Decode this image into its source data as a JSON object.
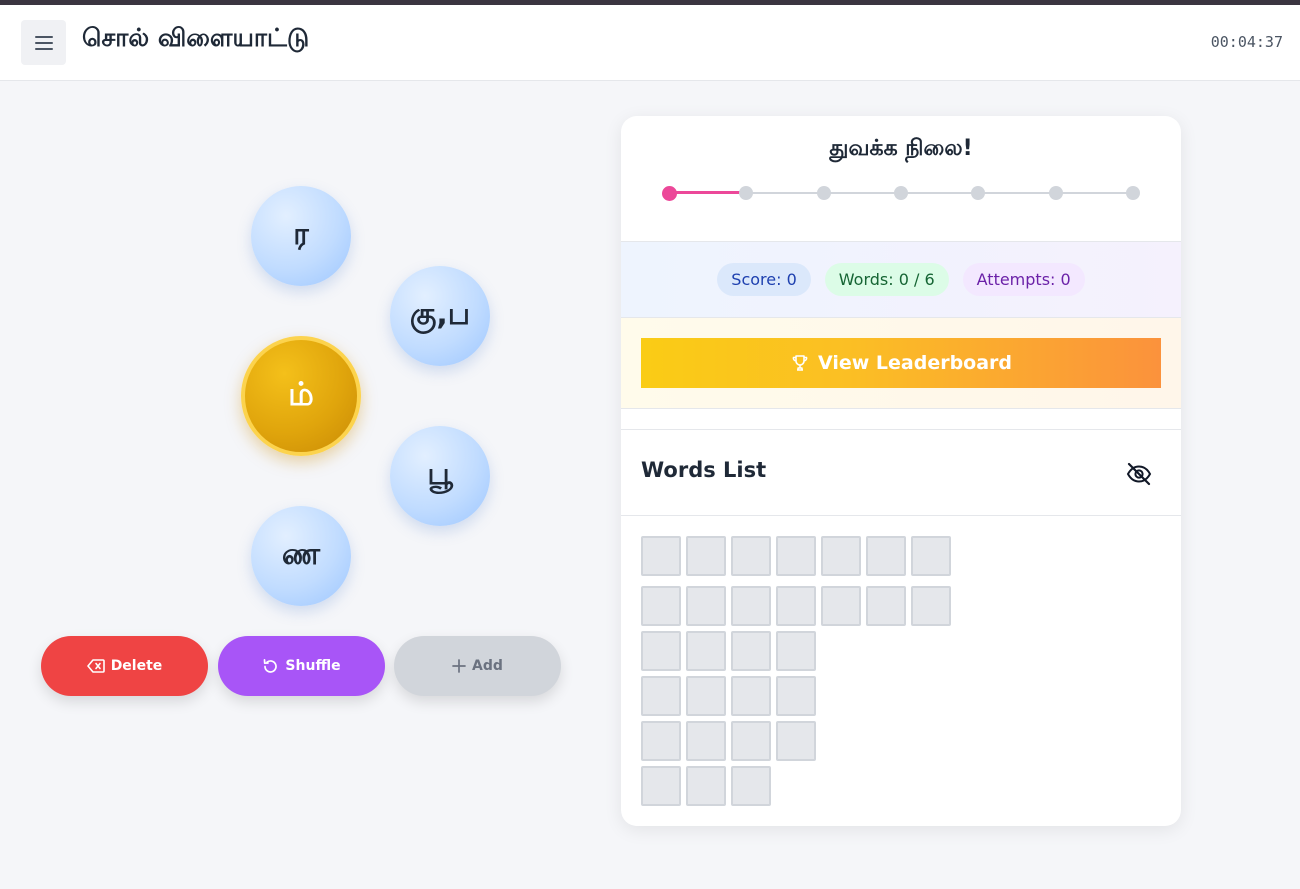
{
  "header": {
    "menu_icon": "hamburger-menu-icon",
    "title": "சொல் விளையாட்டு",
    "timer": "00:04:37"
  },
  "letters": {
    "outer": [
      "ர",
      "கு,ப",
      "பூ",
      "ண"
    ],
    "center": "ம்"
  },
  "actions": {
    "delete_label": "Delete",
    "delete_icon": "backspace-icon",
    "shuffle_label": "Shuffle",
    "shuffle_icon": "rotate-icon",
    "add_label": "Add",
    "add_icon": "plus-icon"
  },
  "level": {
    "title": "துவக்க நிலை!",
    "steps": 7,
    "current_step": 1
  },
  "stats": {
    "score": "Score: 0",
    "words": "Words: 0 / 6",
    "attempts": "Attempts: 0"
  },
  "leaderboard": {
    "label": "View Leaderboard",
    "icon": "trophy-icon"
  },
  "words_list": {
    "title": "Words List",
    "toggle_icon": "eye-off-icon",
    "rows": [
      7,
      7,
      4,
      4,
      4,
      3
    ]
  },
  "colors": {
    "accent_pink": "#ec4899",
    "delete_red": "#ef4444",
    "shuffle_purple": "#a855f7",
    "center_gold": "#e0a50c"
  }
}
